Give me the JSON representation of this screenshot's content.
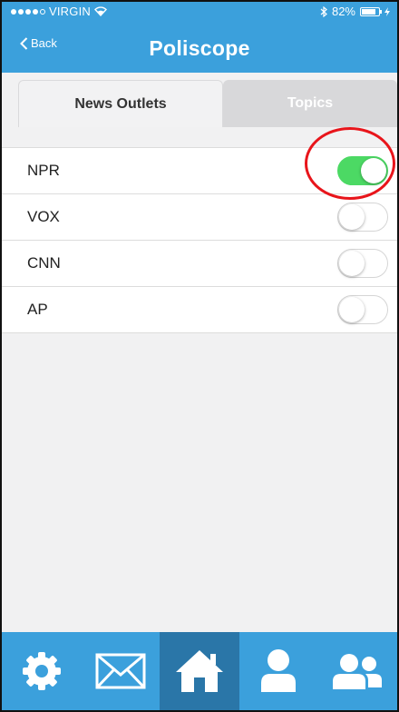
{
  "status_bar": {
    "carrier": "VIRGIN",
    "battery": "82%"
  },
  "header": {
    "back_label": "Back",
    "title": "Poliscope"
  },
  "tabs": [
    {
      "label": "News Outlets",
      "active": true
    },
    {
      "label": "Topics",
      "active": false
    }
  ],
  "outlets": [
    {
      "label": "NPR",
      "enabled": true
    },
    {
      "label": "VOX",
      "enabled": false
    },
    {
      "label": "CNN",
      "enabled": false
    },
    {
      "label": "AP",
      "enabled": false
    }
  ],
  "bottom_nav": [
    {
      "icon": "gear-icon",
      "active": false
    },
    {
      "icon": "mail-icon",
      "active": false
    },
    {
      "icon": "home-icon",
      "active": true
    },
    {
      "icon": "user-icon",
      "active": false
    },
    {
      "icon": "users-icon",
      "active": false
    }
  ],
  "colors": {
    "header": "#3ba0dc",
    "nav_active": "#2a76a8",
    "toggle_on": "#4cd964",
    "highlight": "#e8151b"
  }
}
